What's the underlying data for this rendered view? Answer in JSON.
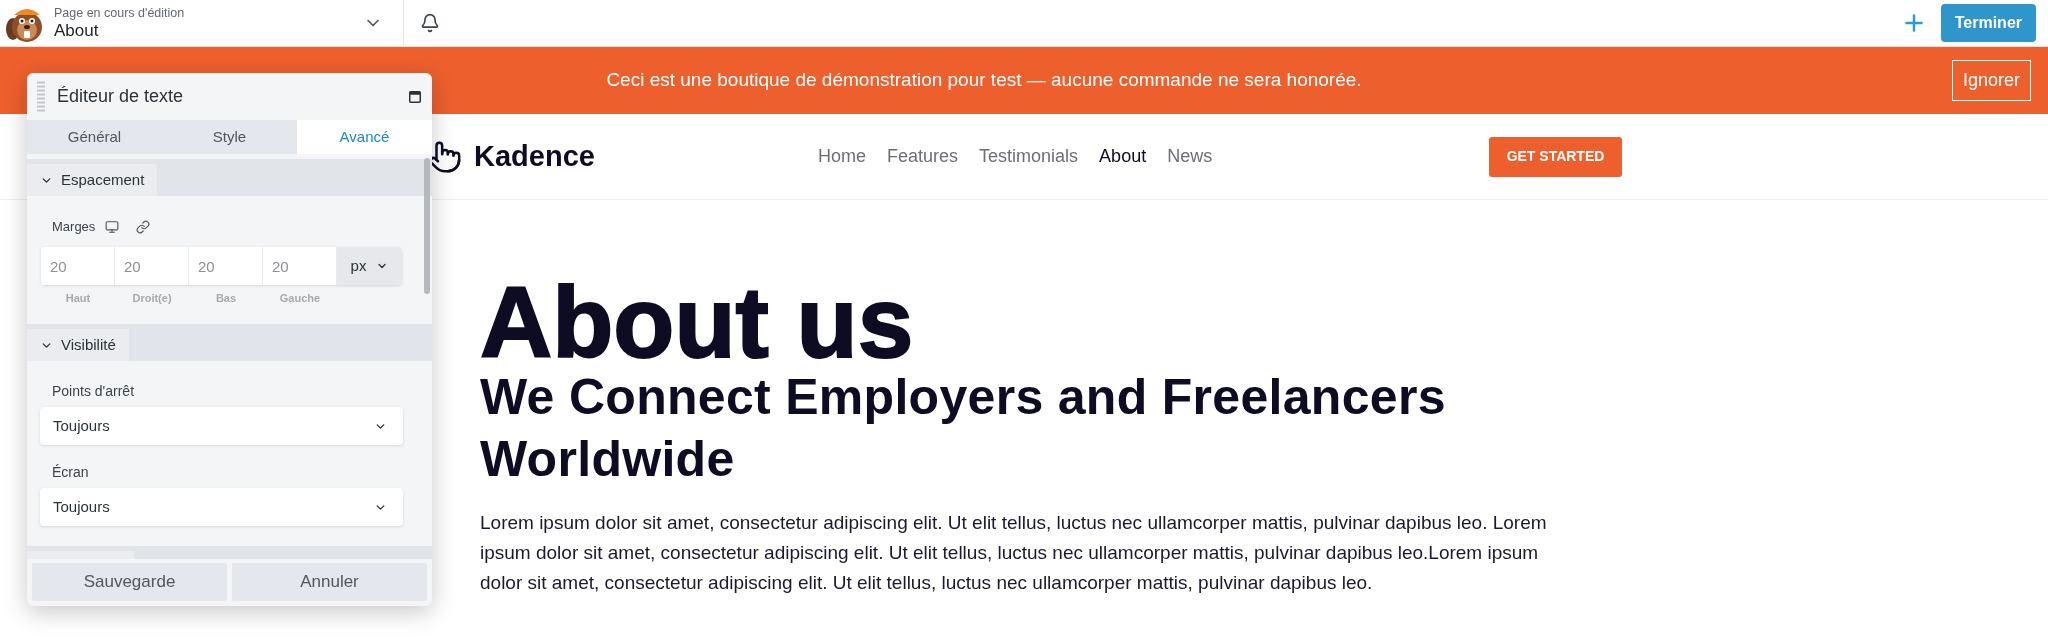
{
  "top_bar": {
    "editing_label": "Page en cours d'édition",
    "page_title": "About",
    "done_button": "Terminer"
  },
  "notice_banner": {
    "message": "Ceci est une boutique de démonstration pour test — aucune commande ne sera honorée.",
    "dismiss_button": "Ignorer"
  },
  "site_header": {
    "brand": "Kadence",
    "nav": [
      {
        "label": "Home",
        "selected": false
      },
      {
        "label": "Features",
        "selected": false
      },
      {
        "label": "Testimonials",
        "selected": false
      },
      {
        "label": "About",
        "selected": true
      },
      {
        "label": "News",
        "selected": false
      }
    ],
    "cta_button": "GET STARTED"
  },
  "hero": {
    "title": "About us",
    "subtitle": "We Connect Employers and Freelancers Worldwide",
    "body": "Lorem ipsum dolor sit amet, consectetur adipiscing elit. Ut elit tellus, luctus nec ullamcorper mattis, pulvinar dapibus leo. Lorem ipsum dolor sit amet, consectetur adipiscing elit. Ut elit tellus, luctus nec ullamcorper mattis, pulvinar dapibus leo.Lorem ipsum dolor sit amet, consectetur adipiscing elit. Ut elit tellus, luctus nec ullamcorper mattis, pulvinar dapibus leo."
  },
  "editor_panel": {
    "title": "Éditeur de texte",
    "tabs": [
      {
        "label": "Général",
        "selected": false
      },
      {
        "label": "Style",
        "selected": false
      },
      {
        "label": "Avancé",
        "selected": true
      }
    ],
    "sections": [
      {
        "kind": "dimension",
        "title": "Espacement",
        "expanded": true,
        "label": "Marges",
        "inputs": [
          {
            "placeholder": "20",
            "caption": "Haut"
          },
          {
            "placeholder": "20",
            "caption": "Droit(e)"
          },
          {
            "placeholder": "20",
            "caption": "Bas"
          },
          {
            "placeholder": "20",
            "caption": "Gauche"
          }
        ],
        "unit": "px"
      },
      {
        "kind": "selects",
        "title": "Visibilité",
        "expanded": true,
        "fields": [
          {
            "label": "Points d'arrêt",
            "value": "Toujours"
          },
          {
            "label": "Écran",
            "value": "Toujours"
          }
        ]
      }
    ],
    "buttons": [
      "Sauvegarde",
      "Annuler"
    ]
  }
}
